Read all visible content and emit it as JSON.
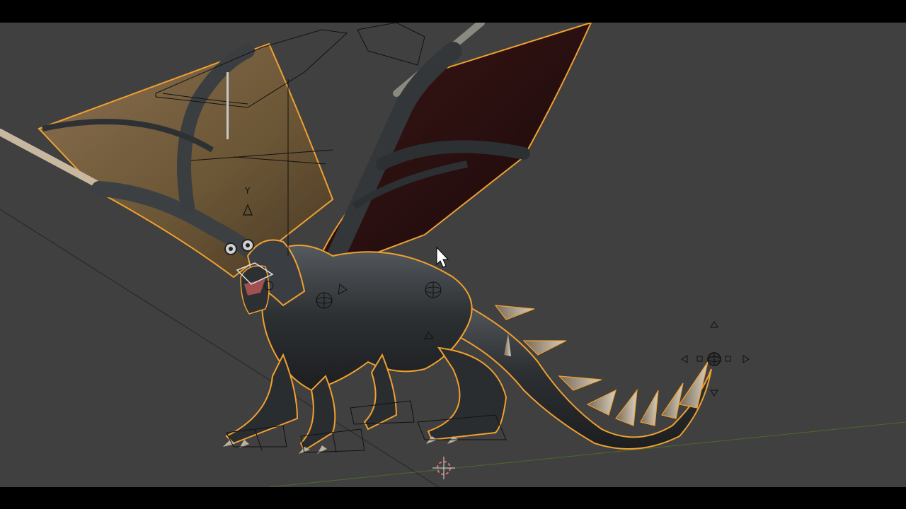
{
  "app": {
    "viewport": {
      "object_name": "",
      "mode": "",
      "icons": {
        "cursor": "mouse-pointer-icon",
        "origin": "3d-cursor-icon",
        "manipulator": "transform-manipulator-icon",
        "empties": "empty-sphere-icon",
        "lamp": "lamp-icon"
      }
    }
  },
  "colors": {
    "viewport_bg": "#404040",
    "selection_outline": "#f0a030",
    "grid_x_axis": "#7a3a3a",
    "grid_y_axis": "#4a6a2a",
    "wireframe": "#111111"
  }
}
